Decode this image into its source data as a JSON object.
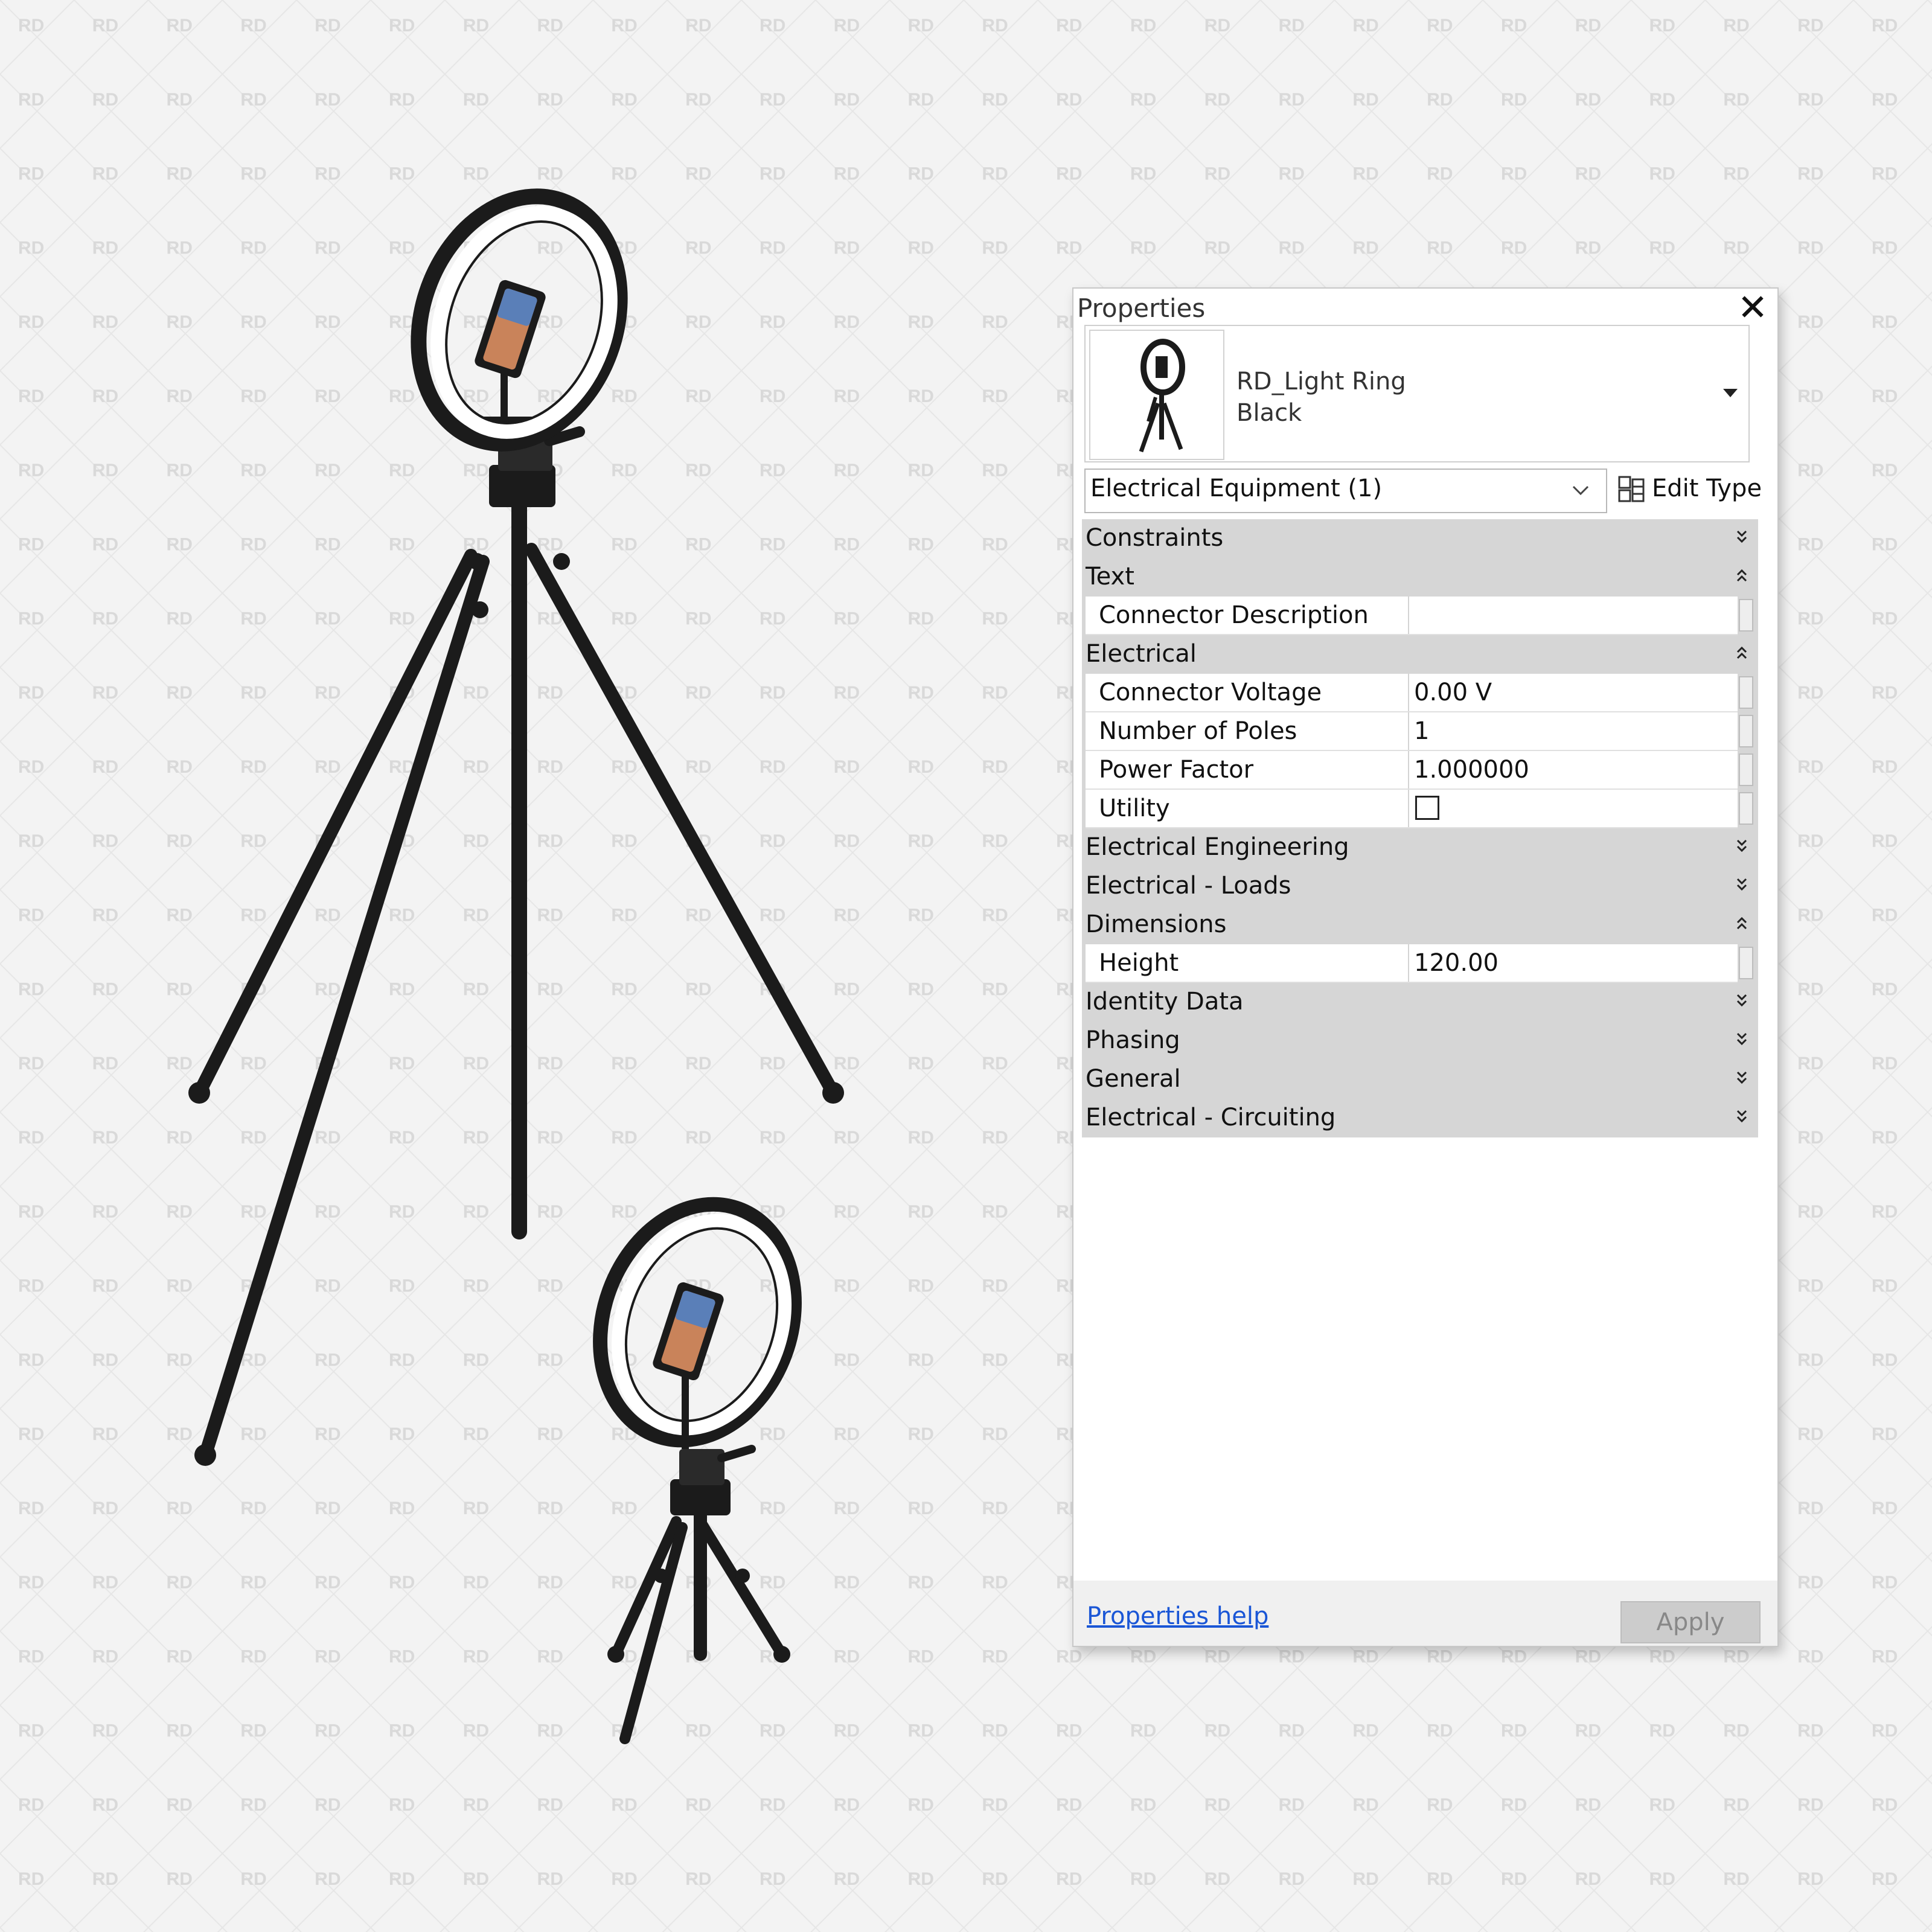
{
  "watermark_text": "RD",
  "panel": {
    "title": "Properties",
    "type_selector": {
      "family_name": "RD_Light Ring",
      "type_name": "Black"
    },
    "filter": {
      "selected": "Electrical Equipment (1)"
    },
    "edit_type_label": "Edit Type",
    "groups": {
      "constraints": "Constraints",
      "text": "Text",
      "electrical": "Electrical",
      "electrical_engineering": "Electrical Engineering",
      "electrical_loads": "Electrical - Loads",
      "dimensions": "Dimensions",
      "identity_data": "Identity Data",
      "phasing": "Phasing",
      "general": "General",
      "electrical_circuiting": "Electrical - Circuiting"
    },
    "params": {
      "connector_description": {
        "name": "Connector Description",
        "value": ""
      },
      "connector_voltage": {
        "name": "Connector Voltage",
        "value": "0.00 V"
      },
      "number_of_poles": {
        "name": "Number of Poles",
        "value": "1"
      },
      "power_factor": {
        "name": "Power Factor",
        "value": "1.000000"
      },
      "utility": {
        "name": "Utility",
        "checked": false
      },
      "height": {
        "name": "Height",
        "value": "120.00"
      }
    },
    "help_link": "Properties help",
    "apply_label": "Apply"
  },
  "colors": {
    "background": "#f3f3f3",
    "group_header": "#d6d6d6",
    "link": "#1a56d6",
    "equipment": "#1b1b1b"
  }
}
